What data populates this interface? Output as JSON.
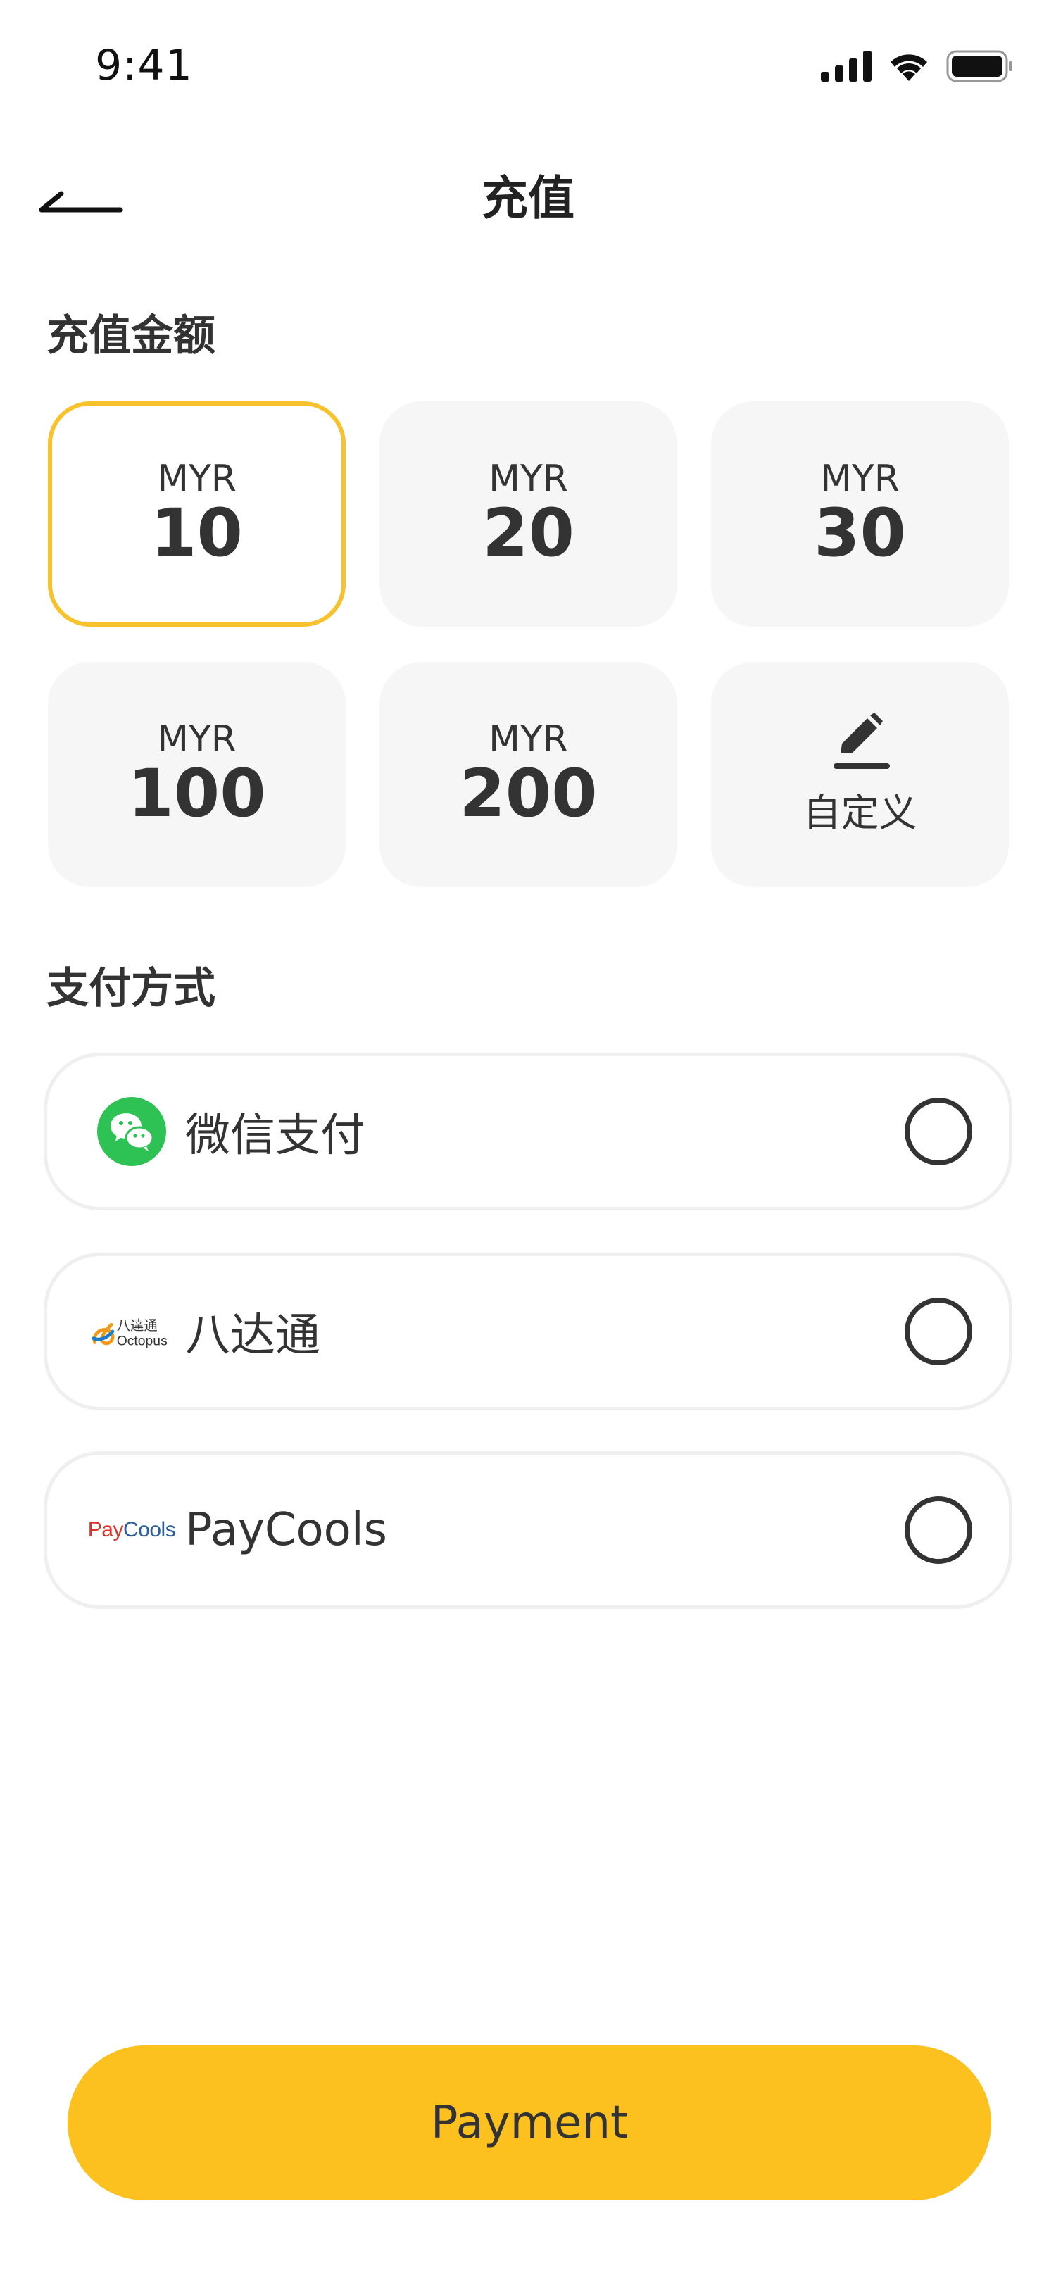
{
  "status_bar": {
    "time": "9:41",
    "icons": [
      "cellular-signal-icon",
      "wifi-icon",
      "battery-icon"
    ]
  },
  "nav": {
    "back_icon": "back-arrow-icon",
    "title": "充值"
  },
  "amount_section": {
    "heading": "充值金额",
    "options": [
      {
        "currency": "MYR",
        "value": "10",
        "selected": true
      },
      {
        "currency": "MYR",
        "value": "20",
        "selected": false
      },
      {
        "currency": "MYR",
        "value": "30",
        "selected": false
      },
      {
        "currency": "MYR",
        "value": "100",
        "selected": false
      },
      {
        "currency": "MYR",
        "value": "200",
        "selected": false
      }
    ],
    "custom": {
      "icon": "edit-pencil-icon",
      "label": "自定义"
    }
  },
  "payment_section": {
    "heading": "支付方式",
    "methods": [
      {
        "label": "微信支付",
        "icon": "wechat-pay-icon",
        "selected": false
      },
      {
        "label": "八达通",
        "icon": "octopus-logo",
        "logo_text_cn": "八達通",
        "logo_text_en": "Octopus",
        "selected": false
      },
      {
        "label": "PayCools",
        "icon": "paycools-logo",
        "logo_text_a": "Pay",
        "logo_text_b": "Cools",
        "selected": false
      }
    ]
  },
  "footer": {
    "button_label": "Payment"
  },
  "colors": {
    "accent": "#fcc01f",
    "selected_border": "#f8c22c",
    "tile_bg": "#f6f6f6",
    "wechat_green": "#2ec154",
    "text": "#333333"
  }
}
